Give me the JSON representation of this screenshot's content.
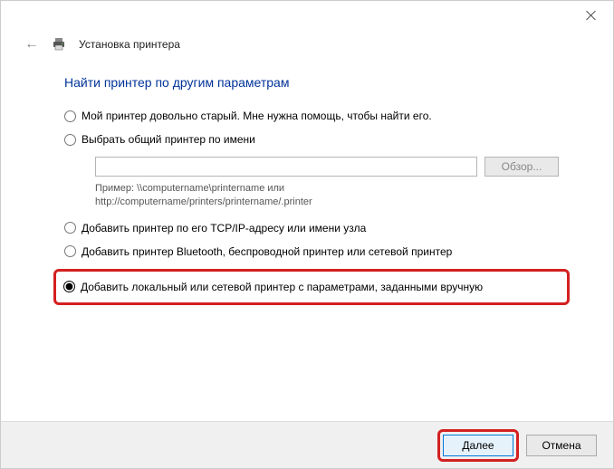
{
  "titlebar": {
    "title": "Установка принтера"
  },
  "heading": "Найти принтер по другим параметрам",
  "options": {
    "old_printer": "Мой принтер довольно старый. Мне нужна помощь, чтобы найти его.",
    "shared_by_name": "Выбрать общий принтер по имени",
    "browse_btn": "Обзор...",
    "hint_line1": "Пример: \\\\computername\\printername или",
    "hint_line2": "http://computername/printers/printername/.printer",
    "tcpip": "Добавить принтер по его TCP/IP-адресу или имени узла",
    "bluetooth": "Добавить принтер Bluetooth, беспроводной принтер или сетевой принтер",
    "local_manual": "Добавить локальный или сетевой принтер с параметрами, заданными вручную"
  },
  "input": {
    "share_name": ""
  },
  "footer": {
    "next": "Далее",
    "cancel": "Отмена"
  }
}
